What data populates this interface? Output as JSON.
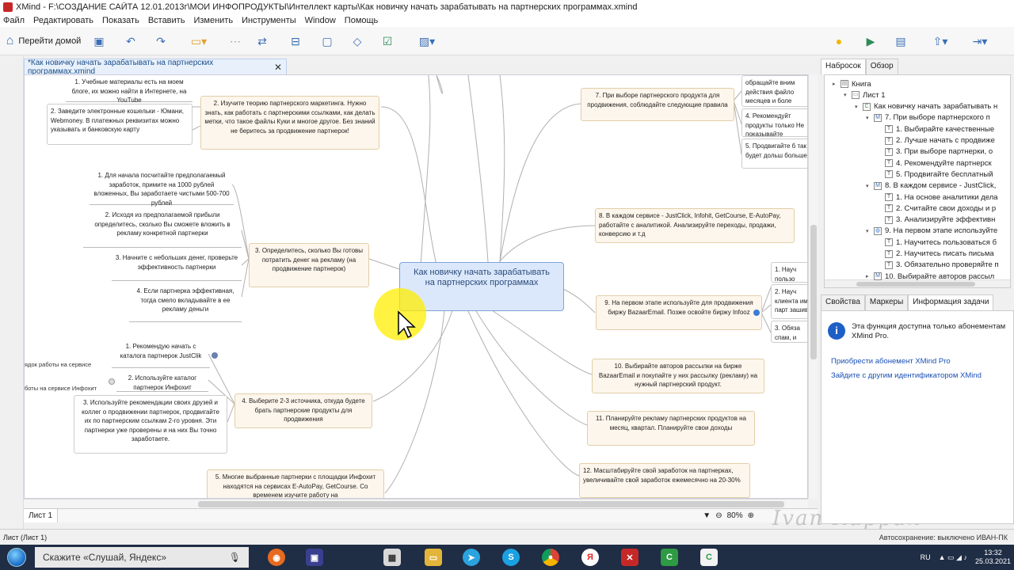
{
  "window": {
    "title": "XMind - F:\\СОЗДАНИЕ САЙТА 12.01.2013г\\МОИ ИНФОПРОДУКТЫ\\Интеллект карты\\Как новичку начать зарабатывать на партнерских программах.xmind"
  },
  "menu": [
    "Файл",
    "Редактировать",
    "Показать",
    "Вставить",
    "Изменить",
    "Инструменты",
    "Window",
    "Помощь"
  ],
  "toolbar": {
    "home_label": "Перейти домой"
  },
  "editor_tab": {
    "label": "*Как новичку начать зарабатывать на партнерских программах.xmind",
    "close": "✕"
  },
  "mindmap": {
    "central": "Как новичку начать зарабатывать на партнерских программах",
    "left_topics": {
      "t2": "2. Изучите теорию партнерского маркетинга. Нужно знать, как работать с партнерскими ссылками, как делать метки, что такое файлы Куки и многое другое. Без знаний не беритесь за продвижение партнерок!",
      "t2_sub1": "1. Учебные материалы есть на моем блоге, их можно найти в Интернете, на YouTube",
      "t2_sub2": "2. Заведите электронные кошельки - Юмани, Webmoney. В платежных реквизитах можно указывать и банковскую карту",
      "t3": "3. Определитесь, сколько Вы готовы потратить денег на рекламу (на продвижение партнерок)",
      "t3_sub1": "1. Для начала посчитайте предполагаемый заработок, примите на 1000 рублей вложенных, Вы заработаете чистыми 500-700 рублей",
      "t3_sub2": "2. Исходя из предполагаемой прибыли определитесь, сколько Вы сможете вложить в рекламу конкретной партнерки",
      "t3_sub3": "3. Начните с небольших денег, проверьте эффективность партнерки",
      "t3_sub4": "4. Если партнерка эффективная, тогда смело вкладывайте в ее рекламу деньги",
      "t4": "4. Выберите 2-3 источника, откуда будете брать партнерские продукты для продвижения",
      "t4_sub1": "1. Рекомендую начать с каталога партнерок JustClik",
      "t4_sub1_note": "ядок работы на сервисе",
      "t4_sub2": "2. Используйте каталог партнерок Инфохит",
      "t4_sub2_note": "боты на сервисе Инфохит",
      "t4_sub3": "3. Используйте рекомендации своих друзей и коллег о продвижении партнерок, продвигайте их по партнерским ссылкам 2-го уровня. Эти партнерки уже проверены и на них Вы точно заработаете.",
      "t5": "5. Многие выбранные партнерки с площадки Инфохит находятся на сервисах E-AutoPay, GetCourse. Со временем изучите работу на"
    },
    "right_topics": {
      "t7": "7. При выборе партнерского продукта для продвижения, соблюдайте следующие правила",
      "t7_sub_a": "обращайте вним действия файло месяцев и боле",
      "t7_sub_b": "4. Рекомендуйт продукты только Не показывайте",
      "t7_sub_c": "5. Продвигайте б так будет дольш больше",
      "t8": "8. В каждом сервисе - JustClick, Infohit, GetCourse, E-AutoPay, работайте с аналитикой. Анализируйте переходы, продажи, конверсию и т.д",
      "t9": "9. На первом этапе используйте для продвижения биржу BazaarEmail. Позже освойте биржу Infooz",
      "t9_sub_a": "1. Науч пользо",
      "t9_sub_b": "2. Науч клиента им парт зашива",
      "t9_sub_c": "3. Обяза спам, и",
      "t10": "10. Выбирайте авторов рассылки на бирже BazaarEmail и покупайте у них рассылку (рекламу) на нужный партнерский продукт.",
      "t11": "11. Планируйте рекламу партнерских продуктов на месяц, квартал. Планируйте свои доходы",
      "t12": "12. Масштабируйте свой заработок на партнерках, увеличивайте свой заработок ежемесячно на 20-30%"
    }
  },
  "sheet_tab": "Лист 1",
  "zoom": "80%",
  "right_panel": {
    "tabs": [
      "Набросок",
      "Обзор"
    ],
    "outline": [
      {
        "indent": 0,
        "icon": "book",
        "text": "Книга",
        "toggle": "▸"
      },
      {
        "indent": 1,
        "icon": "sheet",
        "text": "Лист 1",
        "toggle": "▾"
      },
      {
        "indent": 2,
        "icon": "central",
        "text": "Как новичку начать зарабатывать н",
        "toggle": "▾"
      },
      {
        "indent": 3,
        "icon": "main",
        "text": "7. При выборе партнерского п",
        "toggle": "▾"
      },
      {
        "indent": 4,
        "icon": "topic",
        "text": "1. Выбирайте качественные",
        "toggle": ""
      },
      {
        "indent": 4,
        "icon": "topic",
        "text": "2. Лучше начать с продвиже",
        "toggle": ""
      },
      {
        "indent": 4,
        "icon": "topic",
        "text": "3. При выборе партнерки, о",
        "toggle": ""
      },
      {
        "indent": 4,
        "icon": "topic",
        "text": "4. Рекомендуйте партнерск",
        "toggle": ""
      },
      {
        "indent": 4,
        "icon": "topic",
        "text": "5. Продвигайте бесплатный",
        "toggle": ""
      },
      {
        "indent": 3,
        "icon": "main",
        "text": "8. В каждом сервисе - JustClick,",
        "toggle": "▾"
      },
      {
        "indent": 4,
        "icon": "topic",
        "text": "1. На основе аналитики дела",
        "toggle": ""
      },
      {
        "indent": 4,
        "icon": "topic",
        "text": "2. Считайте свои доходы и р",
        "toggle": ""
      },
      {
        "indent": 4,
        "icon": "topic",
        "text": "3. Анализируйте эффективн",
        "toggle": ""
      },
      {
        "indent": 3,
        "icon": "globe",
        "text": "9. На первом этапе используйте",
        "toggle": "▾"
      },
      {
        "indent": 4,
        "icon": "topic",
        "text": "1. Научитесь пользоваться б",
        "toggle": ""
      },
      {
        "indent": 4,
        "icon": "topic",
        "text": "2. Научитесь писать письма",
        "toggle": ""
      },
      {
        "indent": 4,
        "icon": "topic",
        "text": "3. Обязательно проверяйте п",
        "toggle": ""
      },
      {
        "indent": 3,
        "icon": "main",
        "text": "10. Выбирайте авторов рассыл",
        "toggle": "▸"
      }
    ],
    "lower_tabs": [
      "Свойства",
      "Маркеры",
      "Информация задачи"
    ],
    "info_text": "Эта функция доступна только абонементам XMind Pro.",
    "link1": "Приобрести абонемент XMind Pro",
    "link2": "Зайдите с другим идентификатором XMind"
  },
  "status": {
    "left": "Лист (Лист 1)",
    "right": "Автосохранение: выключено  ИВАН-ПК"
  },
  "taskbar": {
    "search_placeholder": "Скажите «Слушай, Яндекс»",
    "lang": "RU",
    "time": "13:32",
    "date": "25.03.2021"
  },
  "watermark": "Ivan Kuppan"
}
